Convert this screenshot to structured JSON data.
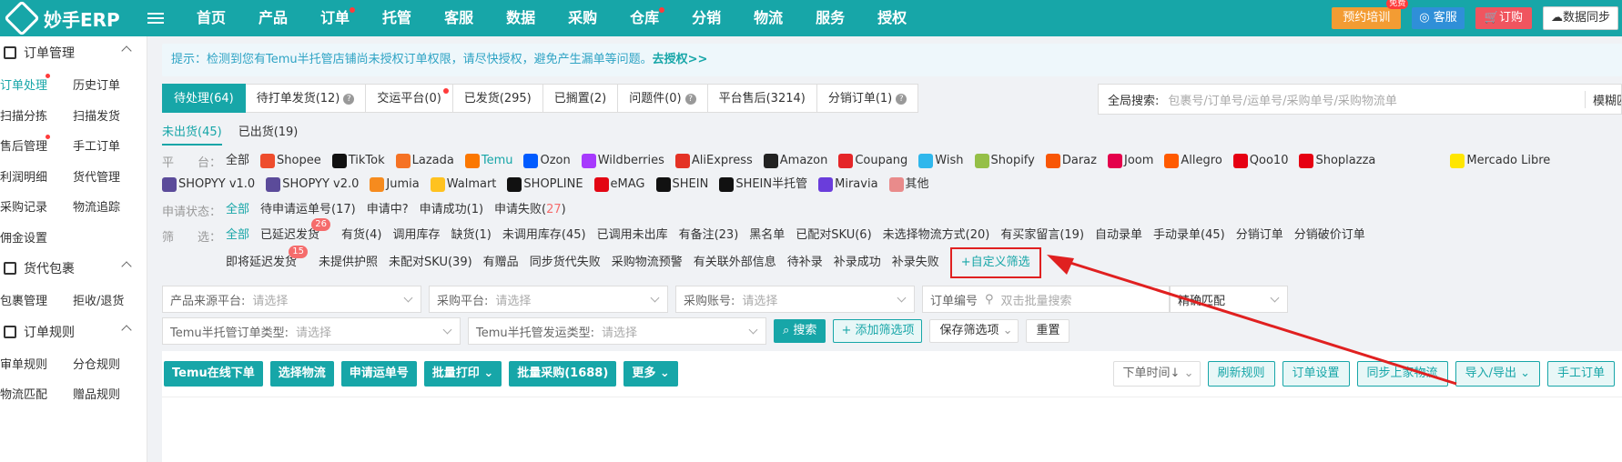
{
  "app": {
    "logo_text": "妙手ERP",
    "nav": [
      {
        "label": "首页",
        "dot": false
      },
      {
        "label": "产品",
        "dot": false
      },
      {
        "label": "订单",
        "dot": true
      },
      {
        "label": "托管",
        "dot": false
      },
      {
        "label": "客服",
        "dot": false
      },
      {
        "label": "数据",
        "dot": false
      },
      {
        "label": "采购",
        "dot": false
      },
      {
        "label": "仓库",
        "dot": true
      },
      {
        "label": "分销",
        "dot": false
      },
      {
        "label": "物流",
        "dot": false
      },
      {
        "label": "服务",
        "dot": false
      },
      {
        "label": "授权",
        "dot": false
      }
    ],
    "top_right": {
      "training": "预约培训",
      "free_badge": "免费",
      "kefu": "客服",
      "order": "订购",
      "sync": "数据同步"
    }
  },
  "sidebar": {
    "groups": [
      {
        "title": "订单管理",
        "rows": [
          [
            {
              "label": "订单处理",
              "active": true,
              "dot": true
            },
            {
              "label": "历史订单"
            }
          ],
          [
            {
              "label": "扫描分拣"
            },
            {
              "label": "扫描发货"
            }
          ],
          [
            {
              "label": "售后管理",
              "dot": true
            },
            {
              "label": "手工订单"
            }
          ],
          [
            {
              "label": "利润明细"
            },
            {
              "label": "货代管理"
            }
          ],
          [
            {
              "label": "采购记录"
            },
            {
              "label": "物流追踪"
            }
          ],
          [
            {
              "label": "佣金设置"
            }
          ]
        ]
      },
      {
        "title": "货代包裹",
        "rows": [
          [
            {
              "label": "包裹管理"
            },
            {
              "label": "拒收/退货"
            }
          ]
        ]
      },
      {
        "title": "订单规则",
        "rows": [
          [
            {
              "label": "审单规则"
            },
            {
              "label": "分仓规则"
            }
          ],
          [
            {
              "label": "物流匹配"
            },
            {
              "label": "赠品规则"
            }
          ]
        ]
      }
    ]
  },
  "notice": {
    "text": "提示：检测到您有Temu半托管店铺尚未授权订单权限，请尽快授权，避免产生漏单等问题。",
    "link": "去授权>>"
  },
  "tabs": [
    {
      "label": "待处理(64)",
      "active": true
    },
    {
      "label": "待打单发货(12)",
      "help": true
    },
    {
      "label": "交运平台(0)",
      "dot": true
    },
    {
      "label": "已发货(295)"
    },
    {
      "label": "已搁置(2)"
    },
    {
      "label": "问题件(0)",
      "help": true
    },
    {
      "label": "平台售后(3214)"
    },
    {
      "label": "分销订单(1)",
      "help": true
    }
  ],
  "global_search": {
    "label": "全局搜索:",
    "placeholder": "包裹号/订单号/运单号/采购单号/采购物流单",
    "mode": "模糊匹"
  },
  "subtabs": [
    {
      "label": "未出货(45)",
      "active": true
    },
    {
      "label": "已出货(19)"
    }
  ],
  "platform_filter": {
    "label": "平　　台：",
    "items": [
      {
        "label": "全部",
        "color": ""
      },
      {
        "label": "Shopee",
        "color": "#ee4d2d"
      },
      {
        "label": "TikTok",
        "color": "#111111"
      },
      {
        "label": "Lazada",
        "color": "#f57224"
      },
      {
        "label": "Temu",
        "color": "#fb7701",
        "active": true
      },
      {
        "label": "Ozon",
        "color": "#005bff"
      },
      {
        "label": "Wildberries",
        "color": "#a73afd"
      },
      {
        "label": "AliExpress",
        "color": "#e43225"
      },
      {
        "label": "Amazon",
        "color": "#222222"
      },
      {
        "label": "Coupang",
        "color": "#e52528"
      },
      {
        "label": "Wish",
        "color": "#2fb7ec"
      },
      {
        "label": "Shopify",
        "color": "#95bf47"
      },
      {
        "label": "Daraz",
        "color": "#f85606"
      },
      {
        "label": "Joom",
        "color": "#e4004b"
      },
      {
        "label": "Allegro",
        "color": "#ff5a00"
      },
      {
        "label": "Qoo10",
        "color": "#e60012"
      },
      {
        "label": "Shoplazza",
        "color": "#e60012"
      },
      {
        "label": "Mercado Libre",
        "color": "#ffe600"
      },
      {
        "label": "SHOPYY v1.0",
        "color": "#5b4b9a"
      },
      {
        "label": "SHOPYY v2.0",
        "color": "#5b4b9a"
      },
      {
        "label": "Jumia",
        "color": "#f68b1e"
      },
      {
        "label": "Walmart",
        "color": "#ffc220"
      },
      {
        "label": "SHOPLINE",
        "color": "#111111"
      },
      {
        "label": "eMAG",
        "color": "#e30613"
      },
      {
        "label": "SHEIN",
        "color": "#111111"
      },
      {
        "label": "SHEIN半托管",
        "color": "#111111"
      },
      {
        "label": "Miravia",
        "color": "#6a3ddb"
      },
      {
        "label": "其他",
        "color": "#e98b8b"
      }
    ]
  },
  "status_filter": {
    "label": "申请状态：",
    "items": [
      {
        "label": "全部",
        "active": true
      },
      {
        "label": "待申请运单号(17)"
      },
      {
        "label": "申请中",
        "help": true
      },
      {
        "label": "申请成功(1)"
      },
      {
        "label": "申请失败(",
        "red": "27",
        "tail": ")"
      }
    ]
  },
  "screen_filter": {
    "label": "筛　　选：",
    "items": [
      {
        "label": "全部",
        "active": true
      },
      {
        "label": "已延迟发货",
        "badge": "26"
      },
      {
        "label": "有货(4)"
      },
      {
        "label": "调用库存"
      },
      {
        "label": "缺货(1)"
      },
      {
        "label": "未调用库存(45)"
      },
      {
        "label": "已调用未出库"
      },
      {
        "label": "有备注(23)"
      },
      {
        "label": "黑名单"
      },
      {
        "label": "已配对SKU(6)"
      },
      {
        "label": "未选择物流方式(20)"
      },
      {
        "label": "有买家留言(19)"
      },
      {
        "label": "自动录单"
      },
      {
        "label": "手动录单(45)"
      },
      {
        "label": "分销订单"
      },
      {
        "label": "分销破价订单"
      }
    ],
    "items2": [
      {
        "label": "即将延迟发货",
        "badge": "15"
      },
      {
        "label": "未提供护照"
      },
      {
        "label": "未配对SKU(39)"
      },
      {
        "label": "有赠品"
      },
      {
        "label": "同步货代失败"
      },
      {
        "label": "采购物流预警"
      },
      {
        "label": "有关联外部信息"
      },
      {
        "label": "待补录"
      },
      {
        "label": "补录成功"
      },
      {
        "label": "补录失败"
      }
    ],
    "custom": "+自定义筛选"
  },
  "form": {
    "row1": [
      {
        "label": "产品来源平台:",
        "placeholder": "请选择"
      },
      {
        "label": "采购平台:",
        "placeholder": "请选择"
      },
      {
        "label": "采购账号:",
        "placeholder": "请选择"
      }
    ],
    "order_no": {
      "label": "订单编号",
      "placeholder": "双击批量搜索"
    },
    "match": "精确匹配",
    "row2": [
      {
        "label": "Temu半托管订单类型:",
        "placeholder": "请选择"
      },
      {
        "label": "Temu半托管发运类型:",
        "placeholder": "请选择"
      }
    ],
    "search_btn": "搜索",
    "add_filter": "+ 添加筛选项",
    "save_filter": "保存筛选项",
    "reset": "重置"
  },
  "actions": {
    "left": [
      "Temu在线下单",
      "选择物流",
      "申请运单号",
      "批量打印",
      "批量采购(1688)",
      "更多"
    ],
    "sort": "下单时间",
    "right": [
      "刷新规则",
      "订单设置",
      "同步上家物流",
      "导入/导出",
      "手工订单"
    ]
  },
  "colors": {
    "accent": "#17a6a8",
    "annotation_red": "#e02020"
  }
}
